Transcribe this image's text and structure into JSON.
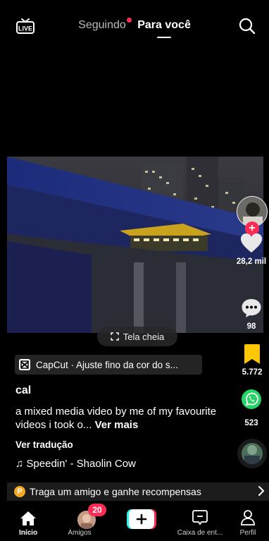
{
  "header": {
    "live_label": "LIVE",
    "tab_following": "Seguindo",
    "tab_foryou": "Para você"
  },
  "video": {
    "fullscreen_label": "Tela cheia"
  },
  "rail": {
    "likes": "28,2 mil",
    "comments": "98",
    "saves": "5.772",
    "shares": "523"
  },
  "post": {
    "capcut_chip": "CapCut · Ajuste fino da cor do s...",
    "username": "cal",
    "caption": "a mixed media video by me of my favourite videos i took o...",
    "see_more": "Ver mais",
    "translate": "Ver tradução",
    "sound": "Speedin' - Shaolin Cow"
  },
  "promo": {
    "text": "Traga um amigo e ganhe recompensas",
    "coin_letter": "P"
  },
  "nav": {
    "home": "Início",
    "friends": "Amigos",
    "friends_badge": "20",
    "inbox": "Caixa de ent...",
    "profile": "Perfil"
  },
  "colors": {
    "accent": "#fe2c55",
    "save": "#fcc600",
    "whatsapp": "#25d366",
    "coin": "#f5a623"
  }
}
